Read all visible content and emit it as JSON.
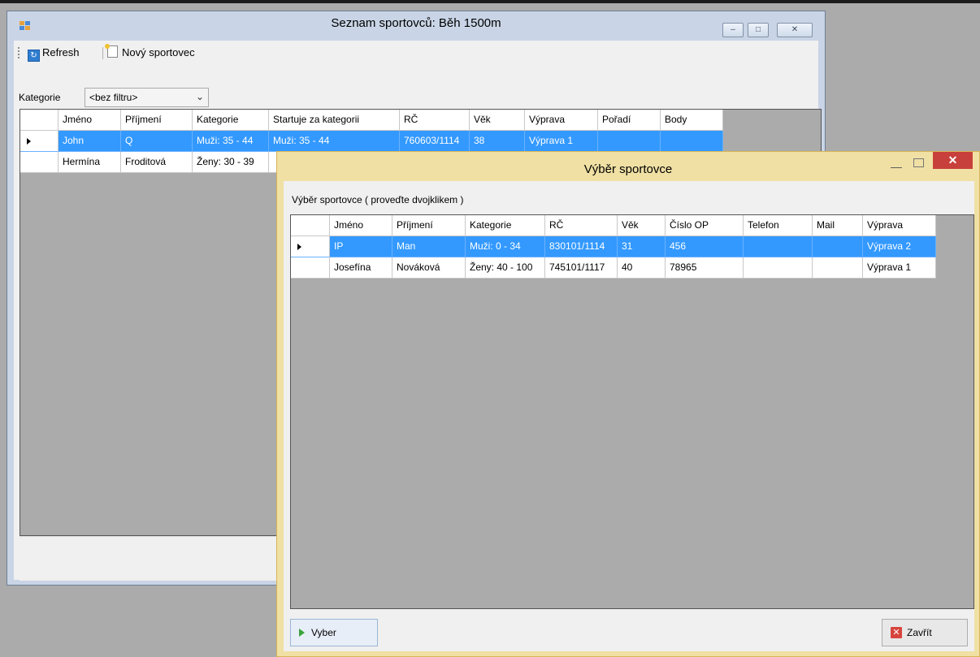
{
  "main_window": {
    "title": "Seznam sportovců: Běh 1500m",
    "toolbar": {
      "refresh_label": "Refresh",
      "new_label": "Nový sportovec"
    },
    "filter": {
      "label": "Kategorie",
      "value": "<bez filtru>"
    },
    "grid": {
      "columns": [
        "Jméno",
        "Příjmení",
        "Kategorie",
        "Startuje za kategorii",
        "RČ",
        "Věk",
        "Výprava",
        "Pořadí",
        "Body"
      ],
      "rows": [
        [
          "John",
          "Q",
          "Muži: 35 - 44",
          "Muži: 35 - 44",
          "760603/1114",
          "38",
          "Výprava 1",
          "",
          ""
        ],
        [
          "Hermína",
          "Froditová",
          "Ženy: 30 - 39",
          "",
          "",
          "",
          "",
          "",
          ""
        ]
      ]
    }
  },
  "dialog": {
    "title": "Výběr sportovce",
    "label": "Výběr sportovce ( proveďte dvojklikem )",
    "grid": {
      "columns": [
        "Jméno",
        "Příjmení",
        "Kategorie",
        "RČ",
        "Věk",
        "Číslo OP",
        "Telefon",
        "Mail",
        "Výprava"
      ],
      "rows": [
        [
          "IP",
          "Man",
          "Muži: 0 - 34",
          "830101/1114",
          "31",
          "456",
          "",
          "",
          "Výprava 2"
        ],
        [
          "Josefína",
          "Nováková",
          "Ženy: 40 - 100",
          "745101/1117",
          "40",
          "78965",
          "",
          "",
          "Výprava 1"
        ]
      ]
    },
    "select_button": "Vyber",
    "close_button": "Zavřít"
  }
}
